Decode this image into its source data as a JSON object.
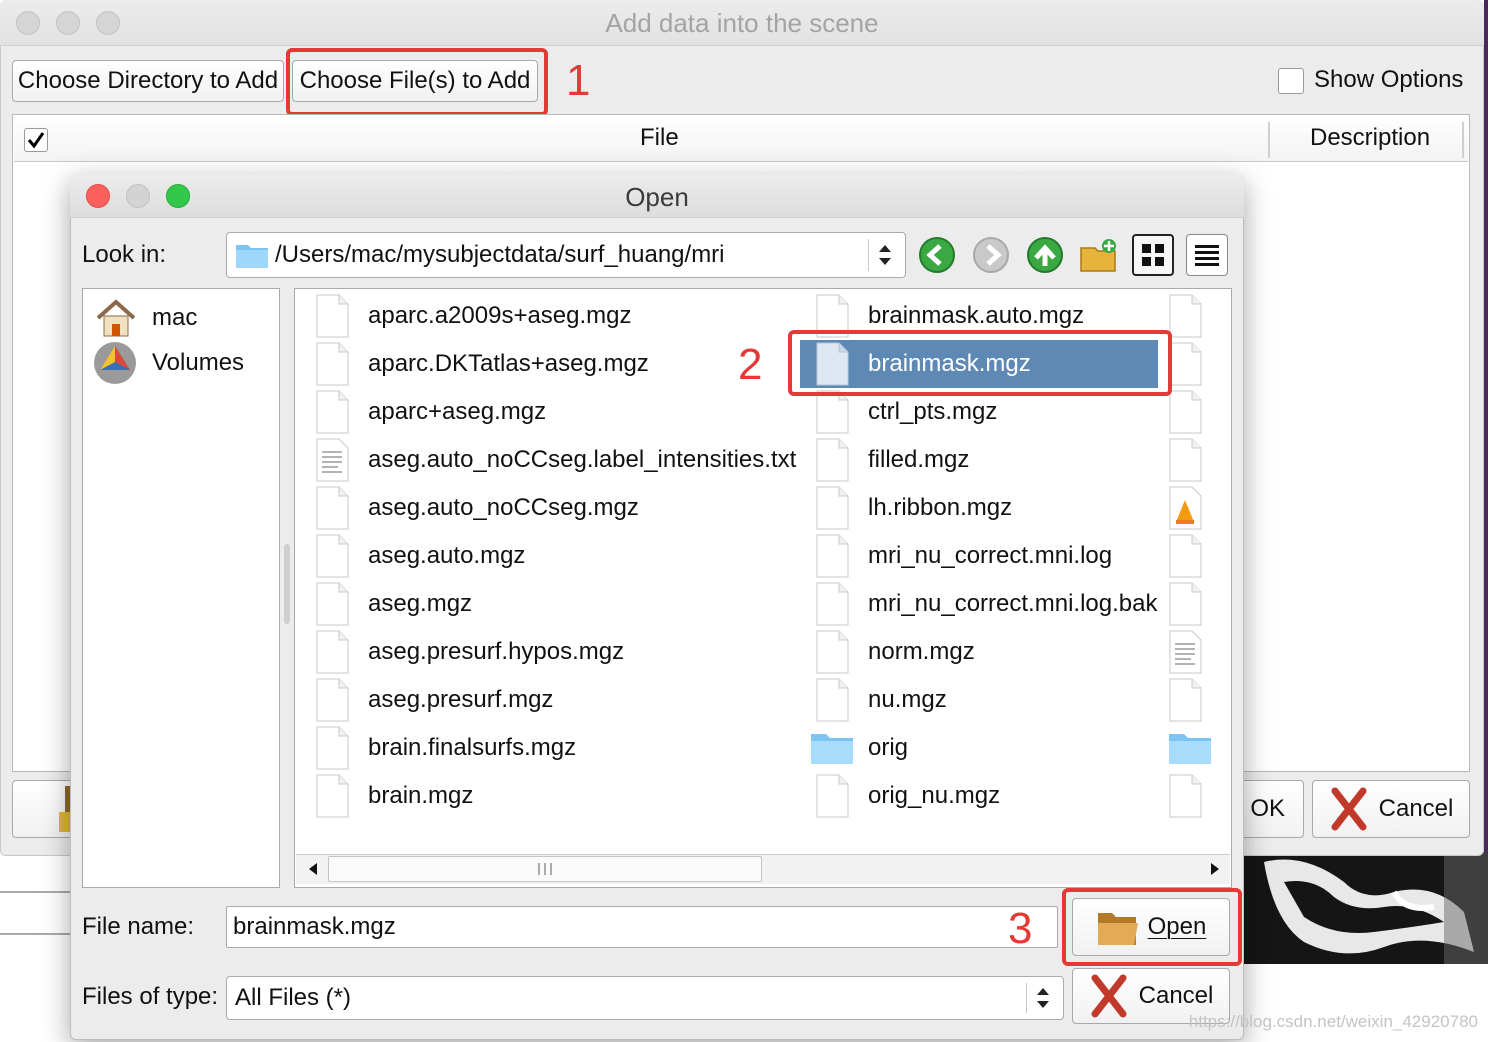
{
  "parent_dialog": {
    "title": "Add data into the scene",
    "choose_directory_label": "Choose Directory to Add",
    "choose_files_label": "Choose File(s) to Add",
    "show_options_label": "Show Options",
    "table_headers": [
      "File",
      "Description"
    ],
    "ok_label": "OK",
    "cancel_label": "Cancel"
  },
  "annotations": [
    "1",
    "2",
    "3"
  ],
  "open_dialog": {
    "title": "Open",
    "look_in_label": "Look in:",
    "path": "/Users/mac/mysubjectdata/surf_huang/mri",
    "sidebar": [
      {
        "label": "mac",
        "icon": "home-icon"
      },
      {
        "label": "Volumes",
        "icon": "drive-icon"
      }
    ],
    "files_col1": [
      {
        "name": "aparc.a2009s+aseg.mgz",
        "icon": "file-icon"
      },
      {
        "name": "aparc.DKTatlas+aseg.mgz",
        "icon": "file-icon"
      },
      {
        "name": "aparc+aseg.mgz",
        "icon": "file-icon"
      },
      {
        "name": "aseg.auto_noCCseg.label_intensities.txt",
        "icon": "text-file-icon"
      },
      {
        "name": "aseg.auto_noCCseg.mgz",
        "icon": "file-icon"
      },
      {
        "name": "aseg.auto.mgz",
        "icon": "file-icon"
      },
      {
        "name": "aseg.mgz",
        "icon": "file-icon"
      },
      {
        "name": "aseg.presurf.hypos.mgz",
        "icon": "file-icon"
      },
      {
        "name": "aseg.presurf.mgz",
        "icon": "file-icon"
      },
      {
        "name": "brain.finalsurfs.mgz",
        "icon": "file-icon"
      },
      {
        "name": "brain.mgz",
        "icon": "file-icon"
      }
    ],
    "files_col2": [
      {
        "name": "brainmask.auto.mgz",
        "icon": "file-icon"
      },
      {
        "name": "brainmask.mgz",
        "icon": "file-icon",
        "selected": true
      },
      {
        "name": "ctrl_pts.mgz",
        "icon": "file-icon"
      },
      {
        "name": "filled.mgz",
        "icon": "file-icon"
      },
      {
        "name": "lh.ribbon.mgz",
        "icon": "file-icon"
      },
      {
        "name": "mri_nu_correct.mni.log",
        "icon": "file-icon"
      },
      {
        "name": "mri_nu_correct.mni.log.bak",
        "icon": "file-icon"
      },
      {
        "name": "norm.mgz",
        "icon": "file-icon"
      },
      {
        "name": "nu.mgz",
        "icon": "file-icon"
      },
      {
        "name": "orig",
        "icon": "folder-icon"
      },
      {
        "name": "orig_nu.mgz",
        "icon": "file-icon"
      }
    ],
    "file_name_label": "File name:",
    "file_name_value": "brainmask.mgz",
    "files_of_type_label": "Files of type:",
    "files_of_type_value": "All Files (*)",
    "open_label": "Open",
    "cancel_label": "Cancel"
  },
  "watermark": "https://blog.csdn.net/weixin_42920780",
  "colors": {
    "selection": "#5e89b5",
    "annotation": "#e53935"
  }
}
